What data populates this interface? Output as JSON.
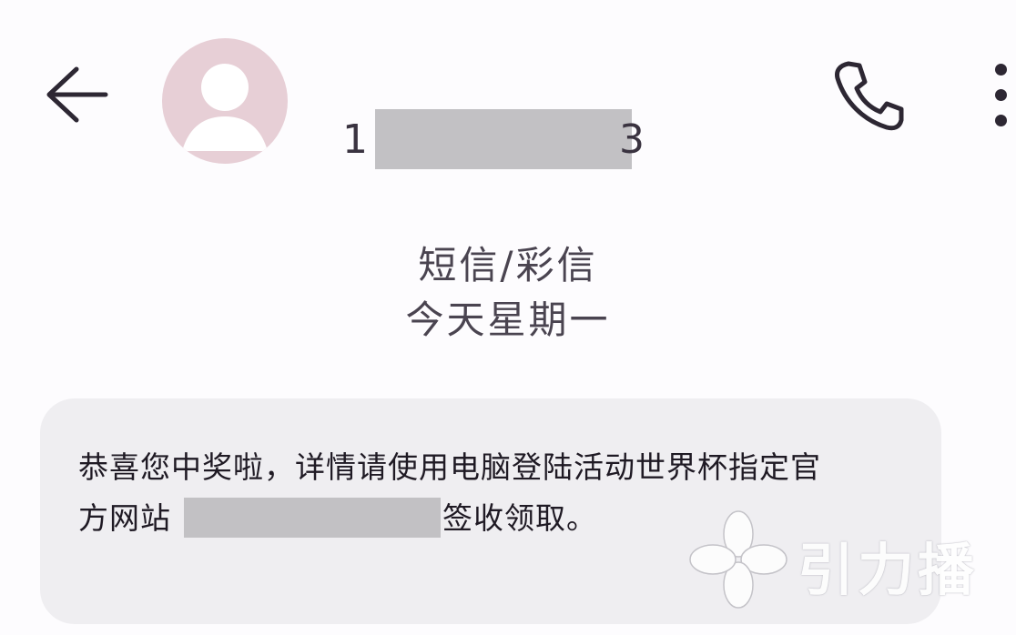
{
  "header": {
    "back_icon": "arrow-left-icon",
    "avatar_icon": "person-icon",
    "contact_number_start": "1",
    "contact_number_end": "3",
    "call_icon": "phone-icon",
    "more_icon": "more-vertical-icon"
  },
  "meta": {
    "message_type": "短信/彩信",
    "date": "今天星期一"
  },
  "message": {
    "line1": "恭喜您中奖啦，详情请使用电脑登陆活动世界杯指定官",
    "line2_prefix": "方网站",
    "line2_suffix": "签收领取。"
  },
  "watermark": {
    "text": "引力播",
    "icon": "flower-logo-icon"
  },
  "colors": {
    "background": "#fdfcfe",
    "avatar": "#e7cfd6",
    "bubble": "#efeef1",
    "redaction": "#c2c1c4"
  }
}
